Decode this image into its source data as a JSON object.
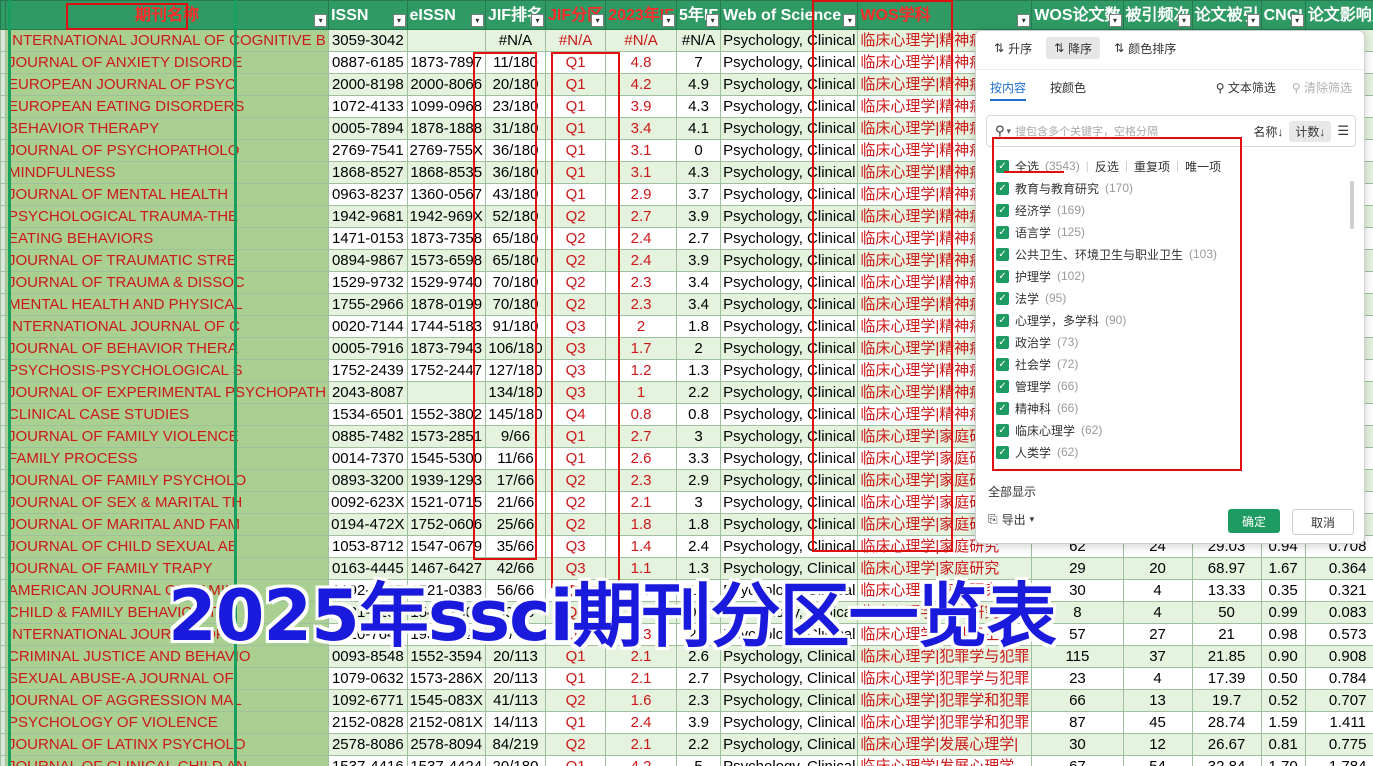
{
  "headers": [
    "期刊名称",
    "ISSN",
    "eISSN",
    "JIF排名",
    "JIF分区",
    "2023年IF",
    "5年IF",
    "Web of Science",
    "WOS学科",
    "WOS论文数",
    "被引频次",
    "论文被引",
    "CNCI",
    "论文影响力"
  ],
  "rows": [
    [
      "INTERNATIONAL JOURNAL OF COGNITIVE B",
      "3059-3042",
      "",
      "#N/A",
      "#N/A",
      "#N/A",
      "#N/A",
      "Psychology, Clinical",
      "临床心理学|精神病学",
      "",
      "",
      "",
      "",
      ""
    ],
    [
      "JOURNAL OF ANXIETY DISORDE",
      "0887-6185",
      "1873-7897",
      "11/180",
      "Q1",
      "4.8",
      "7",
      "Psychology, Clinical",
      "临床心理学|精神病学",
      "",
      "",
      "",
      "",
      ""
    ],
    [
      "EUROPEAN JOURNAL OF PSYC",
      "2000-8198",
      "2000-8066",
      "20/180",
      "Q1",
      "4.2",
      "4.9",
      "Psychology, Clinical",
      "临床心理学|精神病学",
      "",
      "",
      "",
      "",
      ""
    ],
    [
      "EUROPEAN EATING DISORDERS",
      "1072-4133",
      "1099-0968",
      "23/180",
      "Q1",
      "3.9",
      "4.3",
      "Psychology, Clinical",
      "临床心理学|精神病学",
      "",
      "",
      "",
      "",
      ""
    ],
    [
      "BEHAVIOR THERAPY",
      "0005-7894",
      "1878-1888",
      "31/180",
      "Q1",
      "3.4",
      "4.1",
      "Psychology, Clinical",
      "临床心理学|精神病学",
      "",
      "",
      "",
      "",
      ""
    ],
    [
      "JOURNAL OF PSYCHOPATHOLO",
      "2769-7541",
      "2769-755X",
      "36/180",
      "Q1",
      "3.1",
      "0",
      "Psychology, Clinical",
      "临床心理学|精神病学",
      "",
      "",
      "",
      "",
      ""
    ],
    [
      "MINDFULNESS",
      "1868-8527",
      "1868-8535",
      "36/180",
      "Q1",
      "3.1",
      "4.3",
      "Psychology, Clinical",
      "临床心理学|精神病学",
      "",
      "",
      "",
      "",
      ""
    ],
    [
      "JOURNAL OF MENTAL HEALTH",
      "0963-8237",
      "1360-0567",
      "43/180",
      "Q1",
      "2.9",
      "3.7",
      "Psychology, Clinical",
      "临床心理学|精神病学",
      "",
      "",
      "",
      "",
      ""
    ],
    [
      "PSYCHOLOGICAL TRAUMA-THE",
      "1942-9681",
      "1942-969X",
      "52/180",
      "Q2",
      "2.7",
      "3.9",
      "Psychology, Clinical",
      "临床心理学|精神病学",
      "",
      "",
      "",
      "",
      ""
    ],
    [
      "EATING BEHAVIORS",
      "1471-0153",
      "1873-7358",
      "65/180",
      "Q2",
      "2.4",
      "2.7",
      "Psychology, Clinical",
      "临床心理学|精神病学",
      "",
      "",
      "",
      "",
      ""
    ],
    [
      "JOURNAL OF TRAUMATIC STRE",
      "0894-9867",
      "1573-6598",
      "65/180",
      "Q2",
      "2.4",
      "3.9",
      "Psychology, Clinical",
      "临床心理学|精神病学",
      "",
      "",
      "",
      "",
      ""
    ],
    [
      "JOURNAL OF TRAUMA & DISSOC",
      "1529-9732",
      "1529-9740",
      "70/180",
      "Q2",
      "2.3",
      "3.4",
      "Psychology, Clinical",
      "临床心理学|精神病学",
      "",
      "",
      "",
      "",
      ""
    ],
    [
      "MENTAL HEALTH AND PHYSICAL",
      "1755-2966",
      "1878-0199",
      "70/180",
      "Q2",
      "2.3",
      "3.4",
      "Psychology, Clinical",
      "临床心理学|精神病学",
      "",
      "",
      "",
      "",
      ""
    ],
    [
      "INTERNATIONAL JOURNAL OF C",
      "0020-7144",
      "1744-5183",
      "91/180",
      "Q3",
      "2",
      "1.8",
      "Psychology, Clinical",
      "临床心理学|精神病学",
      "",
      "",
      "",
      "",
      ""
    ],
    [
      "JOURNAL OF BEHAVIOR THERA",
      "0005-7916",
      "1873-7943",
      "106/180",
      "Q3",
      "1.7",
      "2",
      "Psychology, Clinical",
      "临床心理学|精神病学",
      "",
      "",
      "",
      "",
      ""
    ],
    [
      "PSYCHOSIS-PSYCHOLOGICAL S",
      "1752-2439",
      "1752-2447",
      "127/180",
      "Q3",
      "1.2",
      "1.3",
      "Psychology, Clinical",
      "临床心理学|精神病学",
      "",
      "",
      "",
      "",
      ""
    ],
    [
      "JOURNAL OF EXPERIMENTAL PSYCHOPATH",
      "2043-8087",
      "",
      "134/180",
      "Q3",
      "1",
      "2.2",
      "Psychology, Clinical",
      "临床心理学|精神病学",
      "",
      "",
      "",
      "",
      ""
    ],
    [
      "CLINICAL CASE STUDIES",
      "1534-6501",
      "1552-3802",
      "145/180",
      "Q4",
      "0.8",
      "0.8",
      "Psychology, Clinical",
      "临床心理学|精神病学",
      "",
      "",
      "",
      "",
      ""
    ],
    [
      "JOURNAL OF FAMILY VIOLENCE",
      "0885-7482",
      "1573-2851",
      "9/66",
      "Q1",
      "2.7",
      "3",
      "Psychology, Clinical",
      "临床心理学|家庭研究",
      "",
      "",
      "",
      "",
      ""
    ],
    [
      "FAMILY PROCESS",
      "0014-7370",
      "1545-5300",
      "11/66",
      "Q1",
      "2.6",
      "3.3",
      "Psychology, Clinical",
      "临床心理学|家庭研究",
      "",
      "",
      "",
      "",
      ""
    ],
    [
      "JOURNAL OF FAMILY PSYCHOLO",
      "0893-3200",
      "1939-1293",
      "17/66",
      "Q2",
      "2.3",
      "2.9",
      "Psychology, Clinical",
      "临床心理学|家庭研究",
      "",
      "",
      "",
      "",
      ""
    ],
    [
      "JOURNAL OF SEX & MARITAL TH",
      "0092-623X",
      "1521-0715",
      "21/66",
      "Q2",
      "2.1",
      "3",
      "Psychology, Clinical",
      "临床心理学|家庭研究",
      "",
      "",
      "",
      "",
      ""
    ],
    [
      "JOURNAL OF MARITAL AND FAM",
      "0194-472X",
      "1752-0606",
      "25/66",
      "Q2",
      "1.8",
      "1.8",
      "Psychology, Clinical",
      "临床心理学|家庭研究",
      "",
      "",
      "",
      "",
      ""
    ],
    [
      "JOURNAL OF CHILD SEXUAL AB",
      "1053-8712",
      "1547-0679",
      "35/66",
      "Q3",
      "1.4",
      "2.4",
      "Psychology, Clinical",
      "临床心理学|家庭研究",
      "62",
      "24",
      "29.03",
      "0.94",
      "0.708"
    ],
    [
      "JOURNAL OF FAMILY TRAPY",
      "0163-4445",
      "1467-6427",
      "42/66",
      "Q3",
      "1.1",
      "1.3",
      "Psychology, Clinical",
      "临床心理学|家庭研究",
      "29",
      "20",
      "68.97",
      "1.67",
      "0.364"
    ],
    [
      "AMERICAN JOURNAL OF FAMILY",
      "0192-6187",
      "1521-0383",
      "56/66",
      "Q3",
      "0.9",
      "1.1",
      "Psychology, Clinical",
      "临床心理学|家庭研究",
      "30",
      "4",
      "13.33",
      "0.35",
      "0.321"
    ],
    [
      "CHILD & FAMILY BEHAVIOR THE",
      "0731-7107",
      "1545-2301",
      "60/66",
      "Q4",
      "0.4",
      "0.5",
      "Psychology, Clinical",
      "临床心理学|家庭研究",
      "8",
      "4",
      "50",
      "0.99",
      "0.083"
    ],
    [
      "INTERNATIONAL JOURNAL OF S",
      "0020-7640",
      "1931-7621",
      "78/403",
      "Q1",
      "2.3",
      "2.6",
      "Psychology, Clinical",
      "临床心理学|公共卫生、",
      "57",
      "27",
      "21",
      "0.98",
      "0.573"
    ],
    [
      "CRIMINAL JUSTICE AND BEHAVIO",
      "0093-8548",
      "1552-3594",
      "20/113",
      "Q1",
      "2.1",
      "2.6",
      "Psychology, Clinical",
      "临床心理学|犯罪学与犯罪",
      "115",
      "37",
      "21.85",
      "0.90",
      "0.908"
    ],
    [
      "SEXUAL ABUSE-A JOURNAL OF",
      "1079-0632",
      "1573-286X",
      "20/113",
      "Q1",
      "2.1",
      "2.7",
      "Psychology, Clinical",
      "临床心理学|犯罪学与犯罪",
      "23",
      "4",
      "17.39",
      "0.50",
      "0.784"
    ],
    [
      "JOURNAL OF AGGRESSION MAL",
      "1092-6771",
      "1545-083X",
      "41/113",
      "Q2",
      "1.6",
      "2.3",
      "Psychology, Clinical",
      "临床心理学|犯罪学和犯罪",
      "66",
      "13",
      "19.7",
      "0.52",
      "0.707"
    ],
    [
      "PSYCHOLOGY OF VIOLENCE",
      "2152-0828",
      "2152-081X",
      "14/113",
      "Q1",
      "2.4",
      "3.9",
      "Psychology, Clinical",
      "临床心理学|犯罪学和犯罪",
      "87",
      "45",
      "28.74",
      "1.59",
      "1.411"
    ],
    [
      "JOURNAL OF LATINX PSYCHOLO",
      "2578-8086",
      "2578-8094",
      "84/219",
      "Q2",
      "2.1",
      "2.2",
      "Psychology, Clinical",
      "临床心理学|发展心理学|",
      "30",
      "12",
      "26.67",
      "0.81",
      "0.775"
    ],
    [
      "JOURNAL OF CLINICAL CHILD AN",
      "1537-4416",
      "1537-4424",
      "20/180",
      "Q1",
      "4.2",
      "5",
      "Psychology, Clinical",
      "临床心理学|发展心理学",
      "67",
      "54",
      "32.84",
      "1.70",
      "1.784"
    ]
  ],
  "filter_popup": {
    "sort_asc": "升序",
    "sort_desc": "降序",
    "sort_color": "颜色排序",
    "tab_content": "按内容",
    "tab_color": "按颜色",
    "text_filter": "文本筛选",
    "clear_filter": "清除筛选",
    "search_placeholder": "搜包含多个关键字，空格分隔",
    "sort_by_name": "名称↓",
    "sort_by_count": "计数↓",
    "select_all": "全选",
    "select_all_count": "(3543)",
    "invert": "反选",
    "duplicates": "重复项",
    "unique": "唯一项",
    "items": [
      {
        "label": "教育与教育研究",
        "count": "(170)"
      },
      {
        "label": "经济学",
        "count": "(169)"
      },
      {
        "label": "语言学",
        "count": "(125)"
      },
      {
        "label": "公共卫生、环境卫生与职业卫生",
        "count": "(103)"
      },
      {
        "label": "护理学",
        "count": "(102)"
      },
      {
        "label": "法学",
        "count": "(95)"
      },
      {
        "label": "心理学，多学科",
        "count": "(90)"
      },
      {
        "label": "政治学",
        "count": "(73)"
      },
      {
        "label": "社会学",
        "count": "(72)"
      },
      {
        "label": "管理学",
        "count": "(66)"
      },
      {
        "label": "精神科",
        "count": "(66)"
      },
      {
        "label": "临床心理学",
        "count": "(62)"
      },
      {
        "label": "人类学",
        "count": "(62)"
      }
    ],
    "show_all": "全部显示",
    "export": "导出",
    "ok": "确定",
    "cancel": "取消"
  },
  "overlay_title": "2025年ssci期刊分区一览表",
  "colors": {
    "header_bg": "#2f9a64",
    "name_bg": "#a9cf91",
    "accent_red": "#e01010",
    "overlay_blue": "#1a1adc",
    "ok_green": "#1e9b62"
  }
}
